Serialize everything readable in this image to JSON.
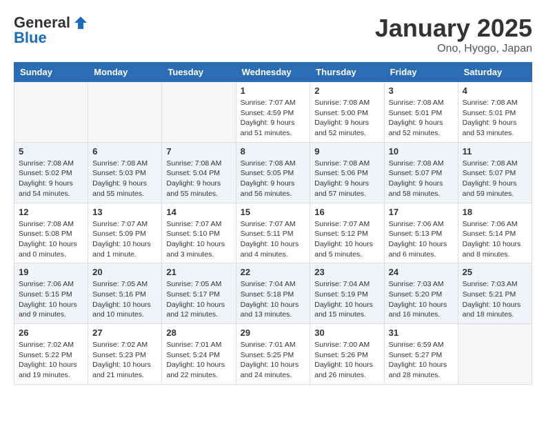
{
  "header": {
    "logo_general": "General",
    "logo_blue": "Blue",
    "month": "January 2025",
    "location": "Ono, Hyogo, Japan"
  },
  "weekdays": [
    "Sunday",
    "Monday",
    "Tuesday",
    "Wednesday",
    "Thursday",
    "Friday",
    "Saturday"
  ],
  "weeks": [
    [
      {
        "day": "",
        "info": ""
      },
      {
        "day": "",
        "info": ""
      },
      {
        "day": "",
        "info": ""
      },
      {
        "day": "1",
        "info": "Sunrise: 7:07 AM\nSunset: 4:59 PM\nDaylight: 9 hours and 51 minutes."
      },
      {
        "day": "2",
        "info": "Sunrise: 7:08 AM\nSunset: 5:00 PM\nDaylight: 9 hours and 52 minutes."
      },
      {
        "day": "3",
        "info": "Sunrise: 7:08 AM\nSunset: 5:01 PM\nDaylight: 9 hours and 52 minutes."
      },
      {
        "day": "4",
        "info": "Sunrise: 7:08 AM\nSunset: 5:01 PM\nDaylight: 9 hours and 53 minutes."
      }
    ],
    [
      {
        "day": "5",
        "info": "Sunrise: 7:08 AM\nSunset: 5:02 PM\nDaylight: 9 hours and 54 minutes."
      },
      {
        "day": "6",
        "info": "Sunrise: 7:08 AM\nSunset: 5:03 PM\nDaylight: 9 hours and 55 minutes."
      },
      {
        "day": "7",
        "info": "Sunrise: 7:08 AM\nSunset: 5:04 PM\nDaylight: 9 hours and 55 minutes."
      },
      {
        "day": "8",
        "info": "Sunrise: 7:08 AM\nSunset: 5:05 PM\nDaylight: 9 hours and 56 minutes."
      },
      {
        "day": "9",
        "info": "Sunrise: 7:08 AM\nSunset: 5:06 PM\nDaylight: 9 hours and 57 minutes."
      },
      {
        "day": "10",
        "info": "Sunrise: 7:08 AM\nSunset: 5:07 PM\nDaylight: 9 hours and 58 minutes."
      },
      {
        "day": "11",
        "info": "Sunrise: 7:08 AM\nSunset: 5:07 PM\nDaylight: 9 hours and 59 minutes."
      }
    ],
    [
      {
        "day": "12",
        "info": "Sunrise: 7:08 AM\nSunset: 5:08 PM\nDaylight: 10 hours and 0 minutes."
      },
      {
        "day": "13",
        "info": "Sunrise: 7:07 AM\nSunset: 5:09 PM\nDaylight: 10 hours and 1 minute."
      },
      {
        "day": "14",
        "info": "Sunrise: 7:07 AM\nSunset: 5:10 PM\nDaylight: 10 hours and 3 minutes."
      },
      {
        "day": "15",
        "info": "Sunrise: 7:07 AM\nSunset: 5:11 PM\nDaylight: 10 hours and 4 minutes."
      },
      {
        "day": "16",
        "info": "Sunrise: 7:07 AM\nSunset: 5:12 PM\nDaylight: 10 hours and 5 minutes."
      },
      {
        "day": "17",
        "info": "Sunrise: 7:06 AM\nSunset: 5:13 PM\nDaylight: 10 hours and 6 minutes."
      },
      {
        "day": "18",
        "info": "Sunrise: 7:06 AM\nSunset: 5:14 PM\nDaylight: 10 hours and 8 minutes."
      }
    ],
    [
      {
        "day": "19",
        "info": "Sunrise: 7:06 AM\nSunset: 5:15 PM\nDaylight: 10 hours and 9 minutes."
      },
      {
        "day": "20",
        "info": "Sunrise: 7:05 AM\nSunset: 5:16 PM\nDaylight: 10 hours and 10 minutes."
      },
      {
        "day": "21",
        "info": "Sunrise: 7:05 AM\nSunset: 5:17 PM\nDaylight: 10 hours and 12 minutes."
      },
      {
        "day": "22",
        "info": "Sunrise: 7:04 AM\nSunset: 5:18 PM\nDaylight: 10 hours and 13 minutes."
      },
      {
        "day": "23",
        "info": "Sunrise: 7:04 AM\nSunset: 5:19 PM\nDaylight: 10 hours and 15 minutes."
      },
      {
        "day": "24",
        "info": "Sunrise: 7:03 AM\nSunset: 5:20 PM\nDaylight: 10 hours and 16 minutes."
      },
      {
        "day": "25",
        "info": "Sunrise: 7:03 AM\nSunset: 5:21 PM\nDaylight: 10 hours and 18 minutes."
      }
    ],
    [
      {
        "day": "26",
        "info": "Sunrise: 7:02 AM\nSunset: 5:22 PM\nDaylight: 10 hours and 19 minutes."
      },
      {
        "day": "27",
        "info": "Sunrise: 7:02 AM\nSunset: 5:23 PM\nDaylight: 10 hours and 21 minutes."
      },
      {
        "day": "28",
        "info": "Sunrise: 7:01 AM\nSunset: 5:24 PM\nDaylight: 10 hours and 22 minutes."
      },
      {
        "day": "29",
        "info": "Sunrise: 7:01 AM\nSunset: 5:25 PM\nDaylight: 10 hours and 24 minutes."
      },
      {
        "day": "30",
        "info": "Sunrise: 7:00 AM\nSunset: 5:26 PM\nDaylight: 10 hours and 26 minutes."
      },
      {
        "day": "31",
        "info": "Sunrise: 6:59 AM\nSunset: 5:27 PM\nDaylight: 10 hours and 28 minutes."
      },
      {
        "day": "",
        "info": ""
      }
    ]
  ]
}
